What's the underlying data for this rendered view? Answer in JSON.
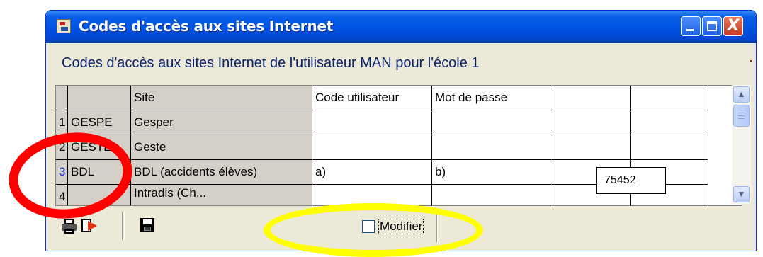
{
  "window": {
    "title": "Codes d'accès aux sites Internet",
    "close_glyph": "X"
  },
  "heading": "Codes d'accès aux sites Internet de l'utilisateur MAN pour l'école 1",
  "table": {
    "headers": [
      "",
      "",
      "Site",
      "Code utilisateur",
      "Mot de passe",
      "",
      ""
    ],
    "rows": [
      [
        "1",
        "GESPE",
        "Gesper",
        "",
        "",
        "",
        ""
      ],
      [
        "2",
        "GESTE",
        "Geste",
        "",
        "",
        "",
        ""
      ],
      [
        "3",
        "BDL",
        "BDL (accidents élèves)",
        "a)",
        "b)",
        "75452",
        ""
      ],
      [
        "4",
        "",
        "Intradis (Ch...",
        "",
        "",
        "",
        ""
      ]
    ],
    "selected_cell_value": "75452"
  },
  "toolbar": {
    "print_icon": "printer-icon",
    "export_icon": "export-icon",
    "save_icon": "floppy-disk-icon",
    "modify_checkbox_checked": false,
    "modify_label": "Modifier"
  },
  "colors": {
    "annotation_red": "#ff0000",
    "annotation_yellow": "#ffff00",
    "titlebar_blue": "#0054e3",
    "selected_row_text": "#1d31c4"
  }
}
